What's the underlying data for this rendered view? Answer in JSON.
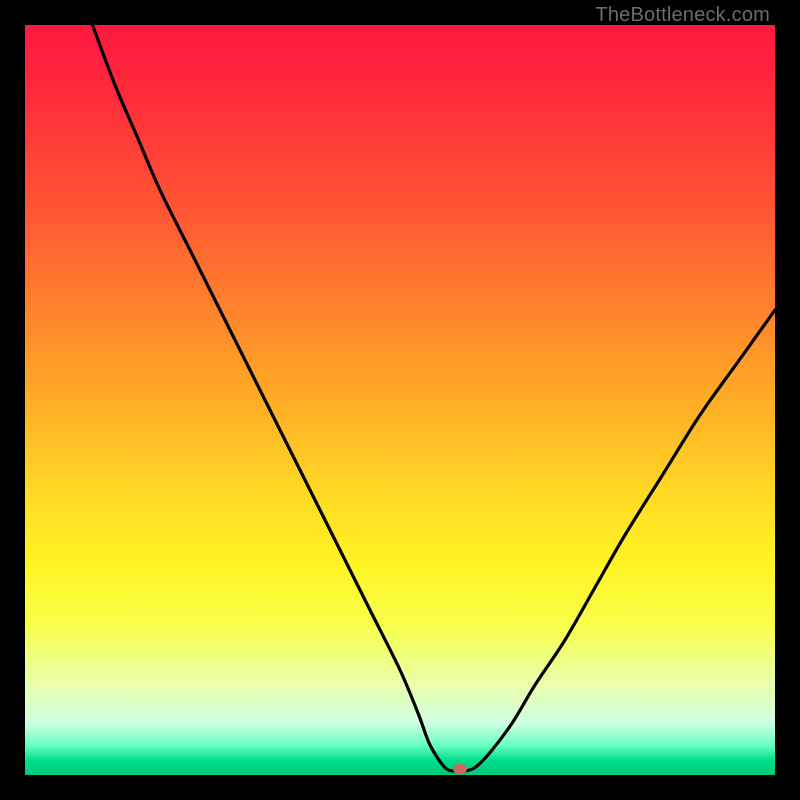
{
  "watermark": "TheBottleneck.com",
  "chart_data": {
    "type": "line",
    "title": "",
    "xlabel": "",
    "ylabel": "",
    "xlim": [
      0,
      100
    ],
    "ylim": [
      0,
      100
    ],
    "series": [
      {
        "name": "bottleneck-curve",
        "x": [
          9,
          12,
          15,
          18,
          22,
          26,
          30,
          34,
          38,
          42,
          46,
          50,
          52.5,
          54,
          56,
          57.5,
          58.5,
          60,
          62,
          65,
          68,
          72,
          76,
          80,
          85,
          90,
          95,
          100
        ],
        "values": [
          100,
          92,
          85,
          78,
          70,
          62,
          54,
          46,
          38,
          30,
          22,
          14,
          8,
          4,
          1,
          0.5,
          0.5,
          1,
          3,
          7,
          12,
          18,
          25,
          32,
          40,
          48,
          55,
          62
        ]
      }
    ],
    "marker": {
      "x": 58,
      "y": 0.8,
      "color": "#c96a5e"
    },
    "colors": {
      "curve": "#000000",
      "background_top": "#ff183f",
      "background_bottom": "#00c878",
      "frame": "#000000"
    }
  }
}
